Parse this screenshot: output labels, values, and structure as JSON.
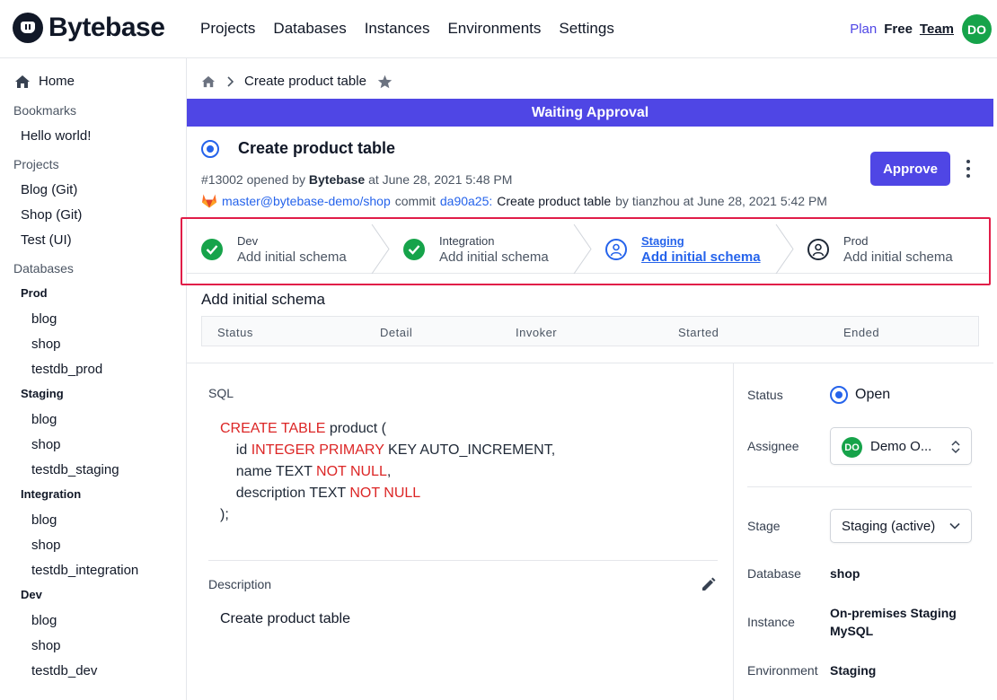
{
  "brand": {
    "name": "Bytebase"
  },
  "nav": {
    "items": [
      "Projects",
      "Databases",
      "Instances",
      "Environments",
      "Settings"
    ]
  },
  "plan": {
    "label": "Plan",
    "value": "Free",
    "upgrade": "Team"
  },
  "user": {
    "initials": "DO",
    "color": "#16a34a"
  },
  "sidebar": {
    "home": "Home",
    "bookmarks_title": "Bookmarks",
    "bookmarks": [
      "Hello world!"
    ],
    "projects_title": "Projects",
    "projects": [
      "Blog (Git)",
      "Shop (Git)",
      "Test (UI)"
    ],
    "databases_title": "Databases",
    "environments": [
      {
        "name": "Prod",
        "dbs": [
          "blog",
          "shop",
          "testdb_prod"
        ]
      },
      {
        "name": "Staging",
        "dbs": [
          "blog",
          "shop",
          "testdb_staging"
        ]
      },
      {
        "name": "Integration",
        "dbs": [
          "blog",
          "shop",
          "testdb_integration"
        ]
      },
      {
        "name": "Dev",
        "dbs": [
          "blog",
          "shop",
          "testdb_dev"
        ]
      }
    ]
  },
  "breadcrumb": {
    "current": "Create product table"
  },
  "banner": {
    "text": "Waiting Approval",
    "color": "#4f46e5"
  },
  "issue": {
    "title": "Create product table",
    "id": "#13002",
    "opened_by_prefix": "opened by",
    "author": "Bytebase",
    "opened_at": "at June 28, 2021 5:48 PM",
    "branch": "master@bytebase-demo/shop",
    "commit_word": "commit",
    "commit_hash": "da90a25:",
    "commit_msg": "Create product table",
    "commit_by": "by tianzhou at June 28, 2021 5:42 PM",
    "approve_label": "Approve"
  },
  "stages": [
    {
      "name": "Dev",
      "task": "Add initial schema",
      "state": "done"
    },
    {
      "name": "Integration",
      "task": "Add initial schema",
      "state": "done"
    },
    {
      "name": "Staging",
      "task": "Add initial schema",
      "state": "active"
    },
    {
      "name": "Prod",
      "task": "Add initial schema",
      "state": "pending"
    }
  ],
  "task": {
    "title": "Add initial schema",
    "columns": [
      "Status",
      "Detail",
      "Invoker",
      "Started",
      "Ended"
    ]
  },
  "sql": {
    "label": "SQL",
    "lines": [
      [
        {
          "k": true,
          "t": "CREATE TABLE"
        },
        {
          "k": false,
          "t": " product ("
        }
      ],
      [
        {
          "k": false,
          "t": "    id "
        },
        {
          "k": true,
          "t": "INTEGER PRIMARY"
        },
        {
          "k": false,
          "t": " KEY AUTO_INCREMENT,"
        }
      ],
      [
        {
          "k": false,
          "t": "    name TEXT "
        },
        {
          "k": true,
          "t": "NOT NULL"
        },
        {
          "k": false,
          "t": ","
        }
      ],
      [
        {
          "k": false,
          "t": "    description TEXT "
        },
        {
          "k": true,
          "t": "NOT NULL"
        }
      ],
      [
        {
          "k": false,
          "t": ");"
        }
      ]
    ]
  },
  "description": {
    "label": "Description",
    "text": "Create product table"
  },
  "panel": {
    "status_label": "Status",
    "status": "Open",
    "assignee_label": "Assignee",
    "assignee_initials": "DO",
    "assignee": "Demo O...",
    "stage_label": "Stage",
    "stage": "Staging (active)",
    "database_label": "Database",
    "database": "shop",
    "instance_label": "Instance",
    "instance": "On-premises Staging MySQL",
    "environment_label": "Environment",
    "environment": "Staging"
  }
}
